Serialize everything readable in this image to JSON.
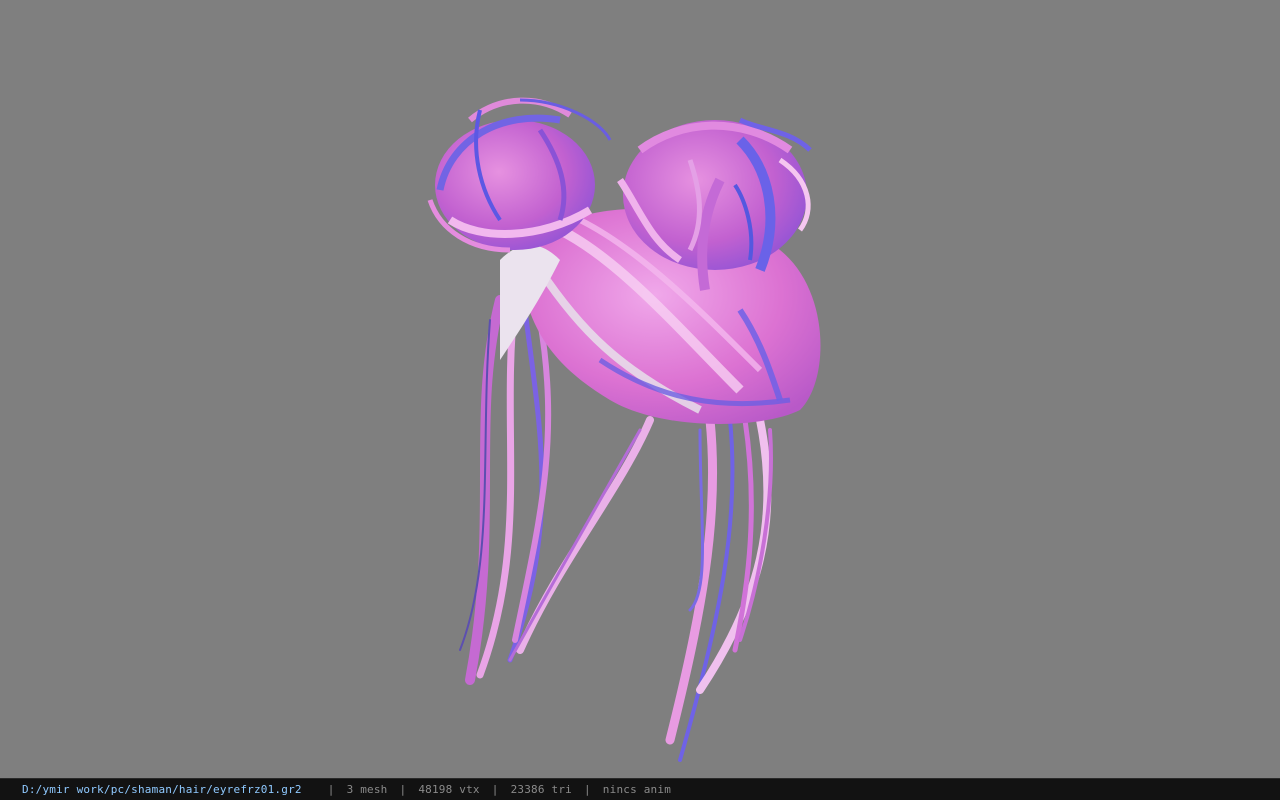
{
  "viewer": {
    "background_color": "#7f7f7f",
    "model": {
      "description": "3D hair mesh (double buns with long strands)",
      "colors": {
        "pink": "#e07ad6",
        "light_pink": "#f3b8ee",
        "purple": "#b24fd0",
        "blue": "#6f62e6",
        "white": "#e9e2ea"
      }
    }
  },
  "status_bar": {
    "file_path": "D:/ymir work/pc/shaman/hair/eyrefrz01.gr2",
    "separator": "|",
    "mesh_count": "3 mesh",
    "vertex_count": "48198 vtx",
    "triangle_count": "23386 tri",
    "anim_status": "nincs anim",
    "path_color": "#8fc9ff",
    "text_color": "#8a8a8a"
  }
}
